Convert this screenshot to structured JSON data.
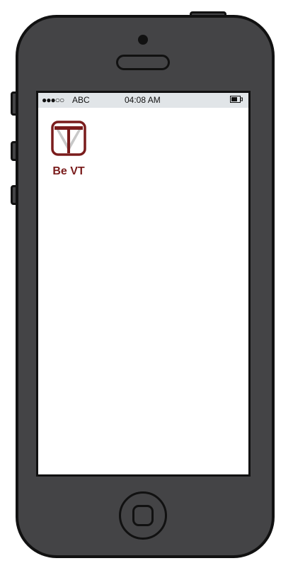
{
  "status_bar": {
    "signal": "●●●○○",
    "carrier": "ABC",
    "time": "04:08 AM",
    "battery_icon": "battery-icon"
  },
  "home_screen": {
    "apps": [
      {
        "label": "Be VT",
        "icon": "be-vt-icon",
        "accent_color": "#7a1c1c"
      }
    ]
  },
  "device": {
    "frame_color": "#444446",
    "screen_color": "#ffffff",
    "status_bar_color": "#e1e5e8"
  }
}
